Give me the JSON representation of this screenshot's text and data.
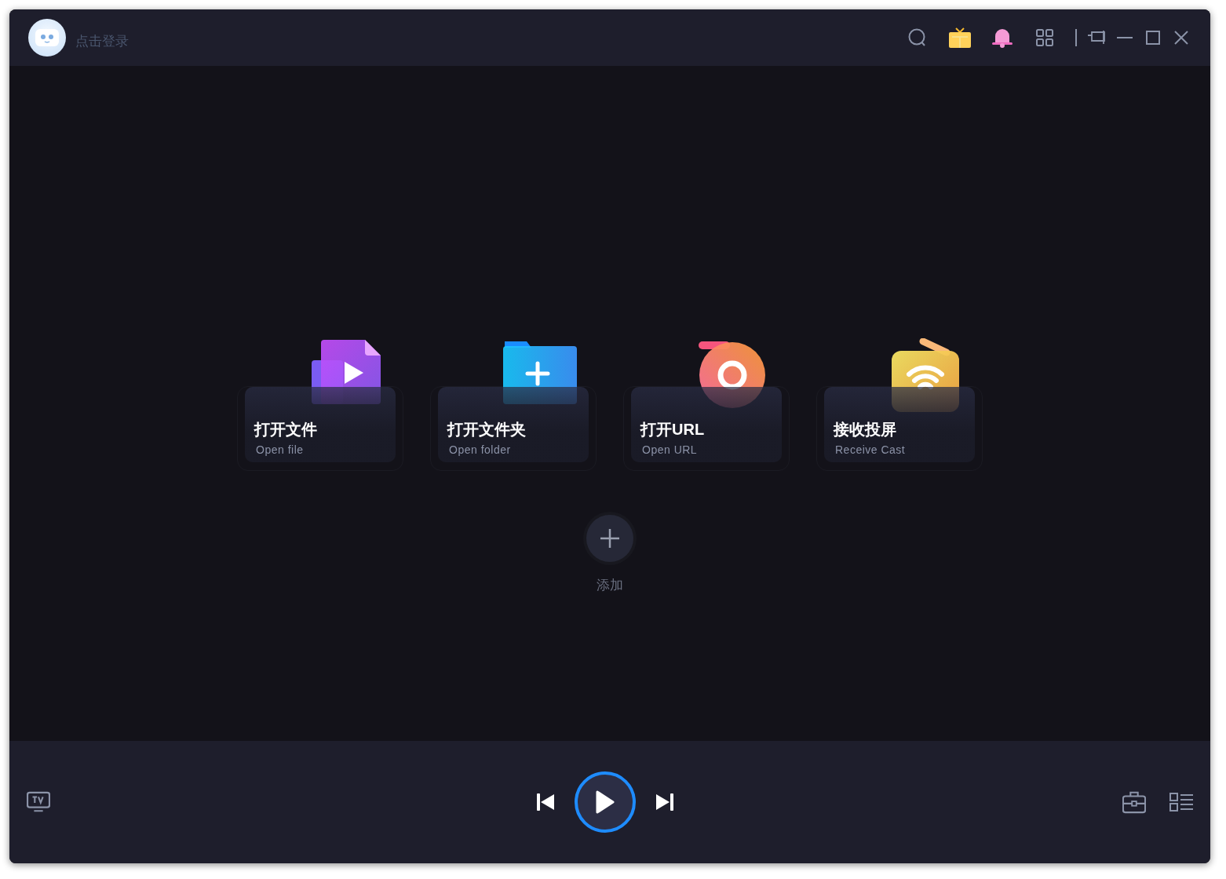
{
  "header": {
    "login": "点击登录"
  },
  "actions": [
    {
      "kind": "file",
      "title": "打开文件",
      "subtitle": "Open file"
    },
    {
      "kind": "folder",
      "title": "打开文件夹",
      "subtitle": "Open folder"
    },
    {
      "kind": "url",
      "title": "打开URL",
      "subtitle": "Open URL"
    },
    {
      "kind": "cast",
      "title": "接收投屏",
      "subtitle": "Receive Cast"
    }
  ],
  "add": {
    "label": "添加"
  }
}
